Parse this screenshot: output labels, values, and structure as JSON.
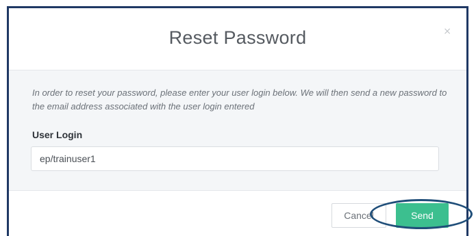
{
  "dialog": {
    "title": "Reset Password",
    "close_label": "×"
  },
  "body": {
    "instructions": "In order to reset your password, please enter your user login below. We will then send a new password to the email address associated with the user login entered",
    "field_label": "User Login",
    "login_value": "ep/trainuser1"
  },
  "footer": {
    "cancel_label": "Cancel",
    "send_label": "Send"
  },
  "colors": {
    "accent": "#3cbf8f",
    "annotation_border": "#1f3864"
  }
}
